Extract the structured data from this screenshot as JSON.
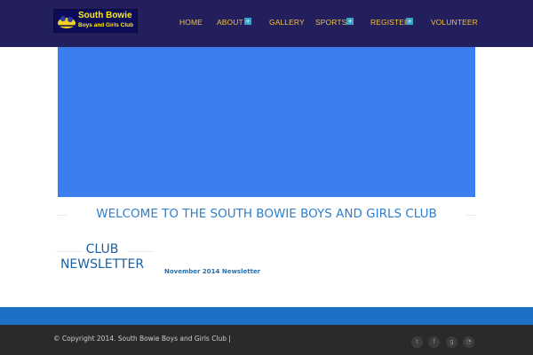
{
  "logo": {
    "line1": "South Bowie",
    "line2": "Boys and Girls Club",
    "accent_color": "#ffee00"
  },
  "nav": {
    "home": "HOME",
    "about": "ABOUT",
    "gallery": "GALLERY",
    "sports": "SPORTS",
    "register": "REGISTER",
    "volunteer": "VOLUNTEER",
    "expand_glyph": "+"
  },
  "welcome": {
    "heading": "WELCOME TO THE SOUTH BOWIE BOYS AND GIRLS CLUB"
  },
  "newsletter": {
    "title_line1": "CLUB",
    "title_line2": "NEWSLETTER",
    "link": "November 2014 Newsletter"
  },
  "footer": {
    "copyright": "© Copyright 2014. South Bowie Boys and Girls Club |",
    "social": [
      {
        "icon": "twitter-icon",
        "glyph": "t"
      },
      {
        "icon": "facebook-icon",
        "glyph": "f"
      },
      {
        "icon": "google-plus-icon",
        "glyph": "g"
      },
      {
        "icon": "rss-icon",
        "glyph": "◔"
      }
    ]
  },
  "colors": {
    "header": "#221f5c",
    "nav_text": "#f0c040",
    "slider": "#3a7ef0",
    "heading": "#2f7fcf",
    "band": "#1e6fc7",
    "footer": "#2a2a2a"
  }
}
